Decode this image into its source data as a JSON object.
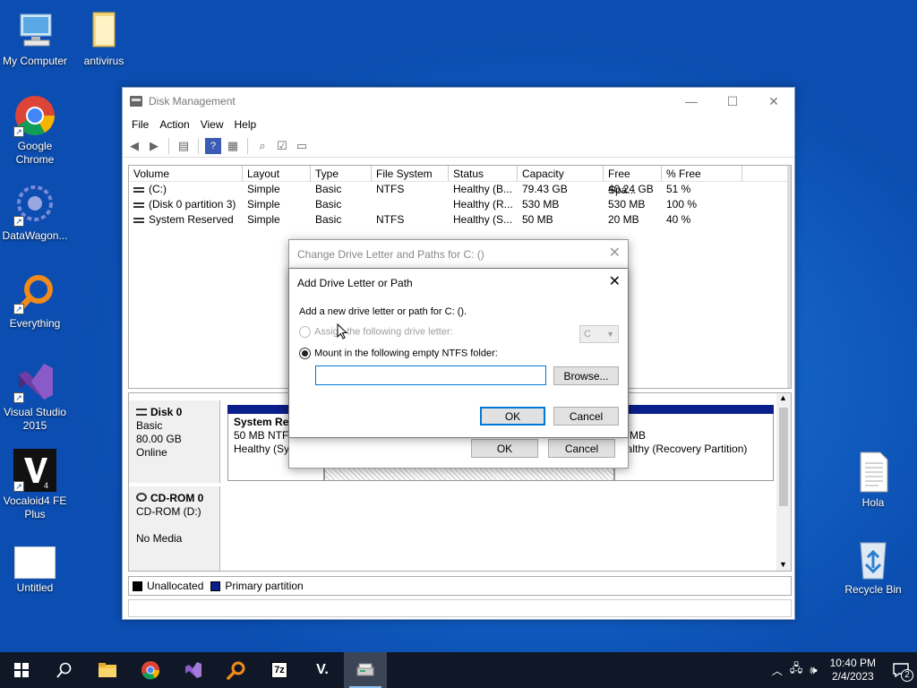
{
  "desktop": {
    "icons": [
      {
        "label": "My Computer"
      },
      {
        "label": "antivirus"
      },
      {
        "label": "Google Chrome"
      },
      {
        "label": "DataWagon..."
      },
      {
        "label": "Everything"
      },
      {
        "label": "Visual Studio 2015"
      },
      {
        "label": "Vocaloid4 FE Plus"
      },
      {
        "label": "Untitled"
      },
      {
        "label": "Hola"
      },
      {
        "label": "Recycle Bin"
      }
    ]
  },
  "window": {
    "title": "Disk Management",
    "menu": [
      "File",
      "Action",
      "View",
      "Help"
    ],
    "volume_columns": [
      "Volume",
      "Layout",
      "Type",
      "File System",
      "Status",
      "Capacity",
      "Free Spa...",
      "% Free"
    ],
    "volumes": [
      [
        "(C:)",
        "Simple",
        "Basic",
        "NTFS",
        "Healthy (B...",
        "79.43 GB",
        "40.24 GB",
        "51 %"
      ],
      [
        "(Disk 0 partition 3)",
        "Simple",
        "Basic",
        "",
        "Healthy (R...",
        "530 MB",
        "530 MB",
        "100 %"
      ],
      [
        "System Reserved",
        "Simple",
        "Basic",
        "NTFS",
        "Healthy (S...",
        "50 MB",
        "20 MB",
        "40 %"
      ]
    ],
    "disk0": {
      "name": "Disk 0",
      "type": "Basic",
      "size": "80.00 GB",
      "state": "Online"
    },
    "disk0_partitions": {
      "p1_name": "System Rese",
      "p1_size": "50 MB NTFS",
      "p1_status": "Healthy (Syst",
      "p3_size": "0 MB",
      "p3_status": "ealthy (Recovery Partition)"
    },
    "cdrom": {
      "name": "CD-ROM 0",
      "type": "CD-ROM (D:)",
      "media": "No Media"
    },
    "legend": {
      "unallocated": "Unallocated",
      "primary": "Primary partition"
    }
  },
  "dialog_change": {
    "title": "Change Drive Letter and Paths for C: ()",
    "ok": "OK",
    "cancel": "Cancel"
  },
  "dialog_add": {
    "title": "Add Drive Letter or Path",
    "intro": "Add a new drive letter or path for C: ().",
    "assign_label": "Assign the following drive letter:",
    "assign_value": "C",
    "mount_label": "Mount in the following empty NTFS folder:",
    "folder_value": "",
    "browse": "Browse...",
    "ok": "OK",
    "cancel": "Cancel"
  },
  "taskbar": {
    "time": "10:40 PM",
    "date": "2/4/2023",
    "notifications": "2"
  },
  "colors": {
    "unallocated": "#000000",
    "primary": "#0b1f8c",
    "accent": "#0078d7"
  }
}
